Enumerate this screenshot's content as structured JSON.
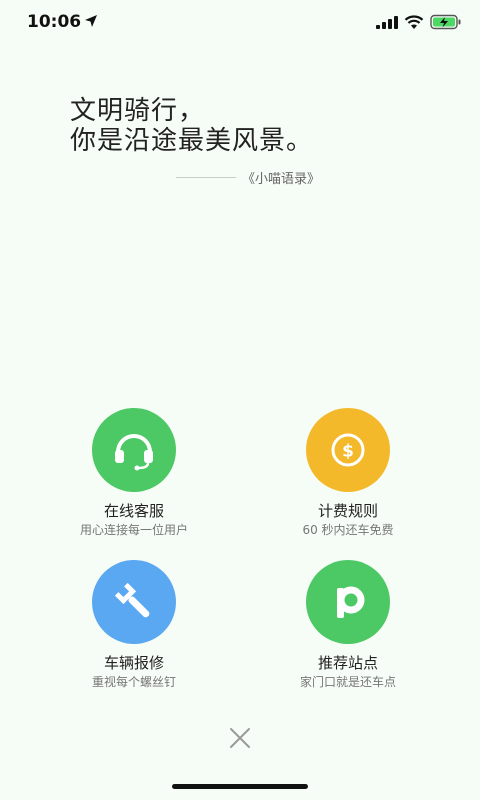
{
  "status": {
    "time": "10:06"
  },
  "quote": {
    "line1": "文明骑行，",
    "line2": "你是沿途最美风景。",
    "source": "《小喵语录》"
  },
  "menu": [
    {
      "title": "在线客服",
      "subtitle": "用心连接每一位用户",
      "icon": "headset-icon",
      "color": "#4cc865"
    },
    {
      "title": "计费规则",
      "subtitle": "60 秒内还车免费",
      "icon": "coin-icon",
      "color": "#f3b92a"
    },
    {
      "title": "车辆报修",
      "subtitle": "重视每个螺丝钉",
      "icon": "wrench-icon",
      "color": "#5aa8f2"
    },
    {
      "title": "推荐站点",
      "subtitle": "家门口就是还车点",
      "icon": "parking-icon",
      "color": "#4cc865"
    }
  ],
  "colors": {
    "background": "#f6fcf6",
    "green": "#4cc865",
    "gold": "#f3b92a",
    "blue": "#5aa8f2"
  }
}
